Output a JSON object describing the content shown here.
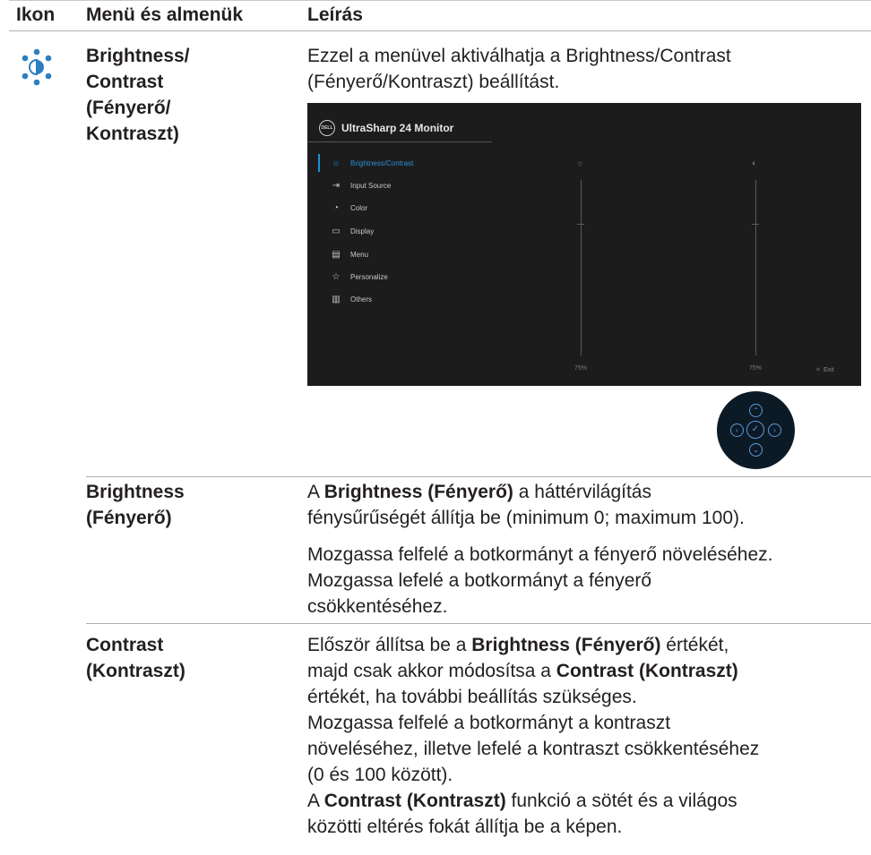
{
  "header": {
    "col_icon": "Ikon",
    "col_menu": "Menü és almenük",
    "col_desc": "Leírás"
  },
  "row1": {
    "icon": "brightness-contrast-icon",
    "menu_lines": [
      "Brightness/",
      "Contrast",
      "(Fényerő/",
      "Kontraszt)"
    ],
    "desc_lines": [
      "Ezzel a menüvel aktiválhatja a Brightness/Contrast",
      "(Fényerő/Kontraszt) beállítást."
    ]
  },
  "osd": {
    "logo": "DELL",
    "title": "UltraSharp 24 Monitor",
    "menu": [
      {
        "icon": "sun-icon",
        "label": "Brightness/Contrast",
        "active": true
      },
      {
        "icon": "input-icon",
        "label": "Input Source"
      },
      {
        "icon": "palette-icon",
        "label": "Color"
      },
      {
        "icon": "monitor-icon",
        "label": "Display"
      },
      {
        "icon": "menu-icon",
        "label": "Menu"
      },
      {
        "icon": "star-icon",
        "label": "Personalize"
      },
      {
        "icon": "others-icon",
        "label": "Others"
      }
    ],
    "brightness_value": "75%",
    "contrast_value": "75%",
    "exit": "Exit",
    "exit_glyph": "<",
    "brightness_glyph": "☼",
    "contrast_glyph": "◐"
  },
  "joystick": {
    "up": "⌃",
    "down": "⌄",
    "left": "‹",
    "right": "›",
    "center": "✓"
  },
  "row2": {
    "menu_lines": [
      "Brightness",
      "(Fényerő)"
    ],
    "p1_prefix": "A ",
    "p1_bold": "Brightness (Fényerő)",
    "p1_rest1": " a háttérvilágítás",
    "p1_line2": "fénysűrűségét állítja be (minimum 0; maximum 100).",
    "p2_lines": [
      "Mozgassa felfelé a botkormányt a fényerő növeléséhez.",
      "Mozgassa lefelé a botkormányt a fényerő",
      "csökkentéséhez."
    ]
  },
  "row3": {
    "menu_lines": [
      "Contrast",
      "(Kontraszt)"
    ],
    "l1_prefix": "Először állítsa be a ",
    "l1_bold": "Brightness (Fényerő)",
    "l1_rest": " értékét,",
    "l2_prefix": "majd csak akkor módosítsa a ",
    "l2_bold": "Contrast (Kontraszt)",
    "l3": "értékét, ha további beállítás szükséges.",
    "l4": "Mozgassa felfelé a botkormányt a kontraszt",
    "l5": "növeléséhez, illetve lefelé a kontraszt csökkentéséhez",
    "l6": "(0 és 100 között).",
    "l7_prefix": "A ",
    "l7_bold": "Contrast (Kontraszt)",
    "l7_rest": " funkció a sötét és a világos",
    "l8": "közötti eltérés fokát állítja be a képen."
  },
  "colors": {
    "accent": "#1e90d6",
    "icon_blue": "#2a7fc1",
    "osd_bg": "#1c1c1c",
    "joystick_bg": "#0c1a26"
  }
}
